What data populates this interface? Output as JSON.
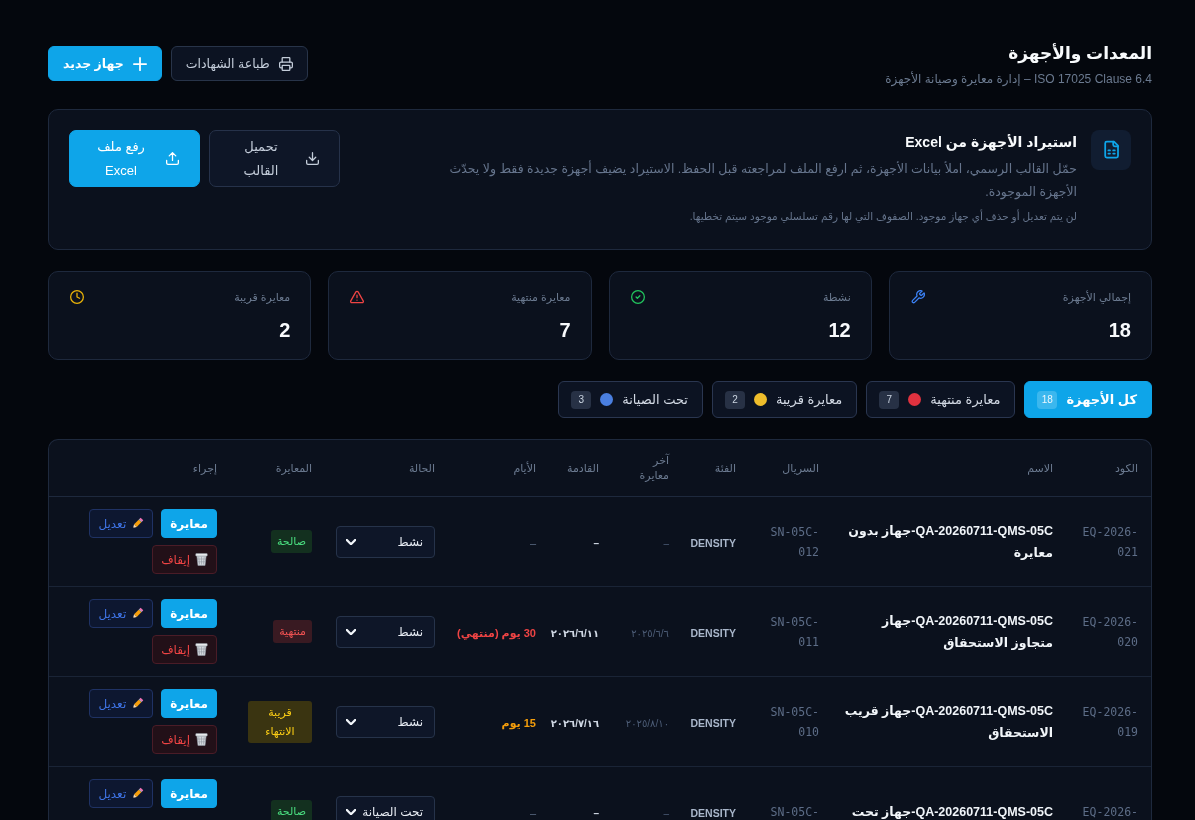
{
  "header": {
    "title": "المعدات والأجهزة",
    "subtitle": "ISO 17025 Clause 6.4 – إدارة معايرة وصيانة الأجهزة",
    "buttons": [
      {
        "label": "طباعة الشهادات",
        "kind": "print"
      },
      {
        "label": "جهاز جديد",
        "kind": "add"
      }
    ]
  },
  "import_panel": {
    "title": "استيراد الأجهزة من Excel",
    "description": "حمّل القالب الرسمي، املأ بيانات الأجهزة، ثم ارفع الملف لمراجعته قبل الحفظ. الاستيراد يضيف أجهزة جديدة فقط ولا يحدّث الأجهزة الموجودة.",
    "note": "لن يتم تعديل أو حذف أي جهاز موجود. الصفوف التي لها رقم تسلسلي موجود سيتم تخطيها.",
    "buttons": [
      {
        "label": "تحميل القالب",
        "kind": "download"
      },
      {
        "label": "رفع ملف Excel",
        "kind": "upload"
      }
    ]
  },
  "stats": [
    {
      "label": "إجمالي الأجهزة",
      "value": "18",
      "kind": "total"
    },
    {
      "label": "نشطة",
      "value": "12",
      "kind": "active"
    },
    {
      "label": "معايرة منتهية",
      "value": "7",
      "kind": "expired"
    },
    {
      "label": "معايرة قريبة",
      "value": "2",
      "kind": "due"
    }
  ],
  "tabs": [
    {
      "label": "كل الأجهزة",
      "count": "18",
      "selected": true
    },
    {
      "label": "معايرة منتهية",
      "count": "7",
      "selected": false,
      "color": "#e0323f"
    },
    {
      "label": "معايرة قريبة",
      "count": "2",
      "selected": false,
      "color": "#eebd2b"
    },
    {
      "label": "تحت الصيانة",
      "count": "3",
      "selected": false,
      "color": "#4a7fe0"
    }
  ],
  "table": {
    "columns": [
      "الكود",
      "الاسم",
      "السريال",
      "الفئة",
      "آخر معايرة",
      "القادمة",
      "الأيام",
      "الحالة",
      "المعايرة",
      "إجراء"
    ],
    "rows": [
      {
        "code": "EQ-2026-021",
        "name": "QA-20260711-QMS-05C-جهاز بدون معايرة",
        "serial": "SN-05C-012",
        "category": "DENSITY",
        "last_calibration": "–",
        "next_calibration": "–",
        "days": {
          "text": "–",
          "kind": "none"
        },
        "status": "نشط",
        "calibration": {
          "label": "صالحة",
          "kind": "valid"
        },
        "actions": [
          {
            "label": "معايرة",
            "kind": "calibrate"
          },
          {
            "label": "تعديل",
            "kind": "edit"
          },
          {
            "label": "إيقاف",
            "kind": "stop"
          }
        ]
      },
      {
        "code": "EQ-2026-020",
        "name": "QA-20260711-QMS-05C-جهاز متجاوز الاستحقاق",
        "serial": "SN-05C-011",
        "category": "DENSITY",
        "last_calibration": "٢٠٢٥/٦/٦",
        "next_calibration": "٢٠٢٦/٦/١١",
        "days": {
          "text": "30 يوم (منتهي)",
          "kind": "overdue"
        },
        "status": "نشط",
        "calibration": {
          "label": "منتهية",
          "kind": "expired"
        },
        "actions": [
          {
            "label": "معايرة",
            "kind": "calibrate"
          },
          {
            "label": "تعديل",
            "kind": "edit"
          },
          {
            "label": "إيقاف",
            "kind": "stop"
          }
        ]
      },
      {
        "code": "EQ-2026-019",
        "name": "QA-20260711-QMS-05C-جهاز قريب الاستحقاق",
        "serial": "SN-05C-010",
        "category": "DENSITY",
        "last_calibration": "٢٠٢٥/٨/١٠",
        "next_calibration": "٢٠٢٦/٧/١٦",
        "days": {
          "text": "15 يوم",
          "kind": "soon"
        },
        "status": "نشط",
        "calibration": {
          "label": "قريبة الانتهاء",
          "kind": "due"
        },
        "actions": [
          {
            "label": "معايرة",
            "kind": "calibrate"
          },
          {
            "label": "تعديل",
            "kind": "edit"
          },
          {
            "label": "إيقاف",
            "kind": "stop"
          }
        ]
      },
      {
        "code": "EQ-2026-",
        "name": "QA-20260711-QMS-05C-جهاز تحت",
        "serial": "SN-05C-",
        "category": "DENSITY",
        "last_calibration": "–",
        "next_calibration": "–",
        "days": {
          "text": "–",
          "kind": "none"
        },
        "status": "تحت الصيانة",
        "calibration": {
          "label": "صالحة",
          "kind": "valid"
        },
        "actions": [
          {
            "label": "معايرة",
            "kind": "calibrate"
          },
          {
            "label": "تعديل",
            "kind": "edit"
          }
        ]
      }
    ]
  }
}
